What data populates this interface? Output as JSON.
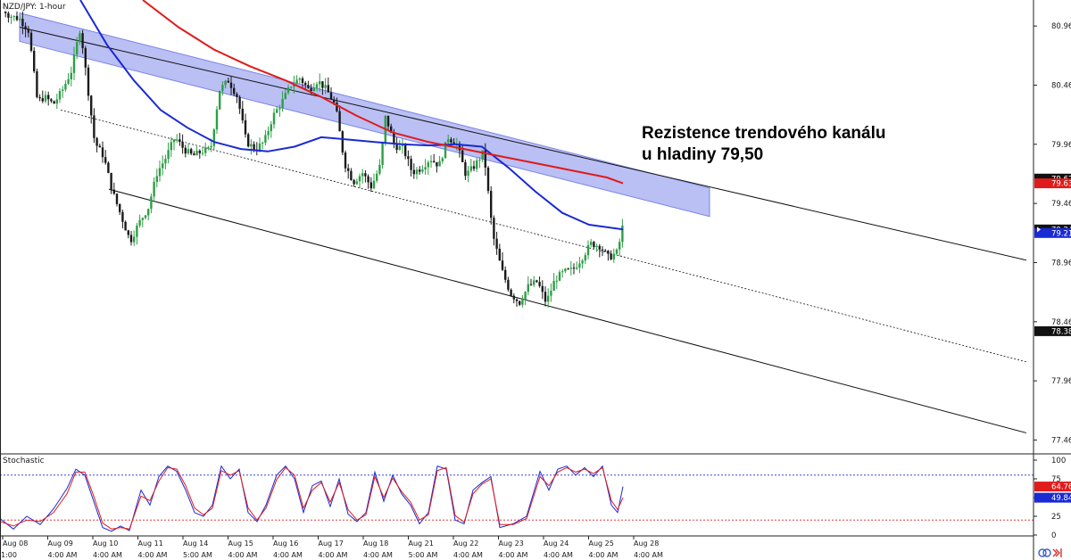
{
  "chart_data": [
    {
      "type": "candlestick",
      "title": "NZD/JPY: 1-hour",
      "y_axis_side": "right",
      "ylim": [
        77.35,
        81.18
      ],
      "y_ticks": [
        "80.96",
        "80.46",
        "79.96",
        "79.46",
        "78.96",
        "78.46",
        "77.96",
        "77.46"
      ],
      "x_categories": [
        {
          "date": "Aug 08",
          "time": "1:00"
        },
        {
          "date": "Aug 09",
          "time": "4:00 AM"
        },
        {
          "date": "Aug 10",
          "time": "4:00 AM"
        },
        {
          "date": "Aug 11",
          "time": "4:00 AM"
        },
        {
          "date": "Aug 14",
          "time": "5:00 AM"
        },
        {
          "date": "Aug 15",
          "time": "4:00 AM"
        },
        {
          "date": "Aug 16",
          "time": "4:00 AM"
        },
        {
          "date": "Aug 17",
          "time": "4:00 AM"
        },
        {
          "date": "Aug 18",
          "time": "4:00 AM"
        },
        {
          "date": "Aug 21",
          "time": "5:00 AM"
        },
        {
          "date": "Aug 22",
          "time": "4:00 AM"
        },
        {
          "date": "Aug 23",
          "time": "4:00 AM"
        },
        {
          "date": "Aug 24",
          "time": "4:00 AM"
        },
        {
          "date": "Aug 25",
          "time": "4:00 AM"
        },
        {
          "date": "Aug 28",
          "time": "4:00 AM"
        }
      ],
      "price_path": [
        [
          0,
          81.14
        ],
        [
          10,
          81.05
        ],
        [
          22,
          81.02
        ],
        [
          32,
          80.92
        ],
        [
          42,
          80.32
        ],
        [
          50,
          80.36
        ],
        [
          60,
          80.3
        ],
        [
          70,
          80.42
        ],
        [
          80,
          80.58
        ],
        [
          90,
          80.95
        ],
        [
          98,
          80.46
        ],
        [
          106,
          79.98
        ],
        [
          116,
          79.86
        ],
        [
          126,
          79.56
        ],
        [
          136,
          79.35
        ],
        [
          146,
          79.14
        ],
        [
          156,
          79.3
        ],
        [
          166,
          79.42
        ],
        [
          176,
          79.72
        ],
        [
          186,
          79.85
        ],
        [
          196,
          80.02
        ],
        [
          206,
          79.92
        ],
        [
          216,
          79.86
        ],
        [
          226,
          79.9
        ],
        [
          236,
          79.92
        ],
        [
          246,
          80.42
        ],
        [
          256,
          80.5
        ],
        [
          266,
          80.36
        ],
        [
          276,
          79.98
        ],
        [
          286,
          79.92
        ],
        [
          296,
          79.98
        ],
        [
          306,
          80.2
        ],
        [
          316,
          80.32
        ],
        [
          326,
          80.46
        ],
        [
          336,
          80.52
        ],
        [
          346,
          80.42
        ],
        [
          356,
          80.5
        ],
        [
          366,
          80.42
        ],
        [
          376,
          80.28
        ],
        [
          386,
          79.8
        ],
        [
          396,
          79.64
        ],
        [
          406,
          79.72
        ],
        [
          416,
          79.6
        ],
        [
          426,
          79.78
        ],
        [
          432,
          80.2
        ],
        [
          442,
          79.95
        ],
        [
          452,
          79.92
        ],
        [
          462,
          79.72
        ],
        [
          472,
          79.76
        ],
        [
          482,
          79.84
        ],
        [
          492,
          79.78
        ],
        [
          502,
          80.02
        ],
        [
          512,
          79.96
        ],
        [
          522,
          79.7
        ],
        [
          532,
          79.78
        ],
        [
          542,
          79.9
        ],
        [
          552,
          79.2
        ],
        [
          562,
          78.9
        ],
        [
          572,
          78.7
        ],
        [
          582,
          78.62
        ],
        [
          592,
          78.76
        ],
        [
          602,
          78.8
        ],
        [
          612,
          78.62
        ],
        [
          622,
          78.82
        ],
        [
          632,
          78.88
        ],
        [
          642,
          78.9
        ],
        [
          652,
          79.0
        ],
        [
          662,
          79.12
        ],
        [
          672,
          79.1
        ],
        [
          682,
          79.0
        ],
        [
          692,
          79.05
        ],
        [
          698,
          79.28
        ]
      ],
      "moving_averages": [
        {
          "color": "#1a2ad4",
          "points": [
            [
              90,
              81.18
            ],
            [
              120,
              80.8
            ],
            [
              150,
              80.5
            ],
            [
              180,
              80.25
            ],
            [
              210,
              80.1
            ],
            [
              240,
              79.98
            ],
            [
              270,
              79.92
            ],
            [
              300,
              79.9
            ],
            [
              330,
              79.94
            ],
            [
              360,
              80.02
            ],
            [
              390,
              80.0
            ],
            [
              420,
              79.98
            ],
            [
              450,
              79.96
            ],
            [
              480,
              79.95
            ],
            [
              510,
              79.96
            ],
            [
              540,
              79.94
            ],
            [
              570,
              79.76
            ],
            [
              600,
              79.56
            ],
            [
              630,
              79.38
            ],
            [
              660,
              79.28
            ],
            [
              698,
              79.24
            ]
          ]
        },
        {
          "color": "#e01b1b",
          "points": [
            [
              160,
              81.18
            ],
            [
              200,
              80.95
            ],
            [
              240,
              80.76
            ],
            [
              280,
              80.62
            ],
            [
              320,
              80.5
            ],
            [
              360,
              80.36
            ],
            [
              400,
              80.2
            ],
            [
              440,
              80.06
            ],
            [
              480,
              79.98
            ],
            [
              520,
              79.92
            ],
            [
              560,
              79.86
            ],
            [
              600,
              79.8
            ],
            [
              640,
              79.74
            ],
            [
              680,
              79.68
            ],
            [
              698,
              79.63
            ]
          ]
        }
      ],
      "channel": {
        "resistance_band": {
          "from": [
            22,
            80.95
          ],
          "to": [
            795,
            79.47
          ],
          "thickness": 0.24
        },
        "upper_line": {
          "from": [
            22,
            80.95
          ],
          "to": [
            1150,
            78.98
          ]
        },
        "mid_line": {
          "from": [
            68,
            80.25
          ],
          "to": [
            1150,
            78.12
          ]
        },
        "lower_line": {
          "from": [
            122,
            79.58
          ],
          "to": [
            1150,
            77.52
          ]
        }
      },
      "price_badges": [
        {
          "label": "79.67",
          "value": 79.67,
          "color": "#111111"
        },
        {
          "label": "79.63",
          "value": 79.63,
          "color": "#e01b1b"
        },
        {
          "label": "79.24",
          "value": 79.24,
          "color": "#111111"
        },
        {
          "label": "79.21",
          "value": 79.21,
          "color": "#1a2ad4"
        },
        {
          "label": "78.38",
          "value": 78.38,
          "color": "#111111"
        }
      ],
      "annotation": {
        "lines": [
          "Rezistence trendového kanálu",
          "u hladiny 79,50"
        ]
      },
      "colors": {
        "up": "#2e9e46",
        "down": "#1a1a1a",
        "band": "#8f97ee"
      }
    },
    {
      "type": "line",
      "title": "Stochastic",
      "ylim": [
        0,
        100
      ],
      "y_ticks": [
        "100",
        "75",
        "50",
        "25",
        "0"
      ],
      "levels": [
        80,
        20
      ],
      "series": [
        {
          "color": "#1a2ad4",
          "points": [
            [
              0,
              22
            ],
            [
              15,
              8
            ],
            [
              30,
              25
            ],
            [
              45,
              14
            ],
            [
              60,
              35
            ],
            [
              75,
              62
            ],
            [
              85,
              88
            ],
            [
              95,
              80
            ],
            [
              105,
              45
            ],
            [
              115,
              10
            ],
            [
              125,
              5
            ],
            [
              135,
              12
            ],
            [
              145,
              6
            ],
            [
              158,
              60
            ],
            [
              168,
              40
            ],
            [
              178,
              78
            ],
            [
              188,
              92
            ],
            [
              198,
              85
            ],
            [
              208,
              60
            ],
            [
              218,
              30
            ],
            [
              228,
              25
            ],
            [
              238,
              40
            ],
            [
              248,
              92
            ],
            [
              258,
              75
            ],
            [
              268,
              88
            ],
            [
              278,
              30
            ],
            [
              288,
              18
            ],
            [
              298,
              40
            ],
            [
              310,
              80
            ],
            [
              320,
              92
            ],
            [
              330,
              75
            ],
            [
              340,
              30
            ],
            [
              350,
              66
            ],
            [
              360,
              72
            ],
            [
              370,
              38
            ],
            [
              380,
              75
            ],
            [
              390,
              28
            ],
            [
              400,
              18
            ],
            [
              410,
              30
            ],
            [
              420,
              84
            ],
            [
              430,
              45
            ],
            [
              440,
              80
            ],
            [
              450,
              55
            ],
            [
              460,
              40
            ],
            [
              470,
              15
            ],
            [
              480,
              30
            ],
            [
              490,
              92
            ],
            [
              500,
              88
            ],
            [
              510,
              20
            ],
            [
              520,
              15
            ],
            [
              530,
              60
            ],
            [
              540,
              70
            ],
            [
              550,
              78
            ],
            [
              560,
              10
            ],
            [
              575,
              15
            ],
            [
              590,
              25
            ],
            [
              605,
              85
            ],
            [
              615,
              60
            ],
            [
              625,
              88
            ],
            [
              635,
              92
            ],
            [
              645,
              80
            ],
            [
              655,
              90
            ],
            [
              665,
              78
            ],
            [
              675,
              92
            ],
            [
              685,
              40
            ],
            [
              692,
              30
            ],
            [
              698,
              64.76
            ]
          ]
        },
        {
          "color": "#e01b1b",
          "points": [
            [
              0,
              18
            ],
            [
              15,
              12
            ],
            [
              30,
              20
            ],
            [
              45,
              18
            ],
            [
              60,
              30
            ],
            [
              75,
              55
            ],
            [
              85,
              84
            ],
            [
              95,
              84
            ],
            [
              105,
              52
            ],
            [
              115,
              16
            ],
            [
              125,
              8
            ],
            [
              135,
              10
            ],
            [
              145,
              8
            ],
            [
              158,
              52
            ],
            [
              168,
              46
            ],
            [
              178,
              72
            ],
            [
              188,
              90
            ],
            [
              198,
              88
            ],
            [
              208,
              66
            ],
            [
              218,
              36
            ],
            [
              228,
              27
            ],
            [
              238,
              36
            ],
            [
              248,
              86
            ],
            [
              258,
              80
            ],
            [
              268,
              86
            ],
            [
              278,
              36
            ],
            [
              288,
              20
            ],
            [
              298,
              36
            ],
            [
              310,
              74
            ],
            [
              320,
              90
            ],
            [
              330,
              80
            ],
            [
              340,
              36
            ],
            [
              350,
              60
            ],
            [
              360,
              70
            ],
            [
              370,
              44
            ],
            [
              380,
              70
            ],
            [
              390,
              34
            ],
            [
              400,
              20
            ],
            [
              410,
              27
            ],
            [
              420,
              78
            ],
            [
              430,
              50
            ],
            [
              440,
              76
            ],
            [
              450,
              58
            ],
            [
              460,
              44
            ],
            [
              470,
              20
            ],
            [
              480,
              27
            ],
            [
              490,
              86
            ],
            [
              500,
              90
            ],
            [
              510,
              26
            ],
            [
              520,
              17
            ],
            [
              530,
              55
            ],
            [
              540,
              68
            ],
            [
              550,
              75
            ],
            [
              560,
              14
            ],
            [
              575,
              14
            ],
            [
              590,
              22
            ],
            [
              605,
              78
            ],
            [
              615,
              66
            ],
            [
              625,
              84
            ],
            [
              635,
              90
            ],
            [
              645,
              84
            ],
            [
              655,
              88
            ],
            [
              665,
              82
            ],
            [
              675,
              90
            ],
            [
              685,
              46
            ],
            [
              692,
              34
            ],
            [
              698,
              49.84
            ]
          ]
        }
      ],
      "value_badges": [
        {
          "label": "64.76",
          "value": 64.76,
          "color": "#e01b1b"
        },
        {
          "label": "49.84",
          "value": 49.84,
          "color": "#1a2ad4"
        }
      ]
    }
  ],
  "icons": {
    "first": "linked-circles-icon",
    "second": "jump-to-latest-icon"
  }
}
